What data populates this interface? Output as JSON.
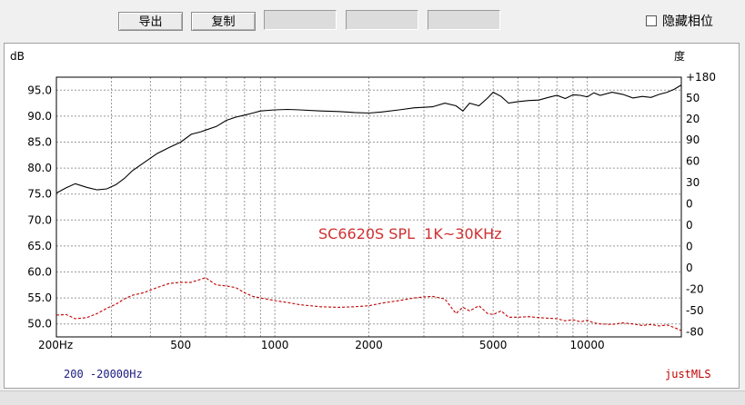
{
  "toolbar": {
    "export_label": "导出",
    "copy_label": "复制",
    "hide_phase_label": "隐藏相位",
    "hide_phase_checked": false
  },
  "colors": {
    "spl_line": "#000000",
    "phase_line": "#c00000",
    "annotation": "#d03030",
    "brand": "#c00000",
    "range_text": "#1a1a80",
    "grid": "#9a9a9a"
  },
  "chart_data": {
    "type": "line",
    "x_scale": "log",
    "xlim": [
      200,
      20000
    ],
    "ylim": [
      47.5,
      97.5
    ],
    "ylabel": "dB",
    "y2label": "度",
    "x_ticks": [
      {
        "v": 200,
        "label": "200Hz"
      },
      {
        "v": 500,
        "label": "500"
      },
      {
        "v": 1000,
        "label": "1000"
      },
      {
        "v": 2000,
        "label": "2000"
      },
      {
        "v": 5000,
        "label": "5000"
      },
      {
        "v": 10000,
        "label": "10000"
      }
    ],
    "y_ticks": [
      {
        "v": 95,
        "label": "95.0"
      },
      {
        "v": 90,
        "label": "90.0"
      },
      {
        "v": 85,
        "label": "85.0"
      },
      {
        "v": 80,
        "label": "80.0"
      },
      {
        "v": 75,
        "label": "75.0"
      },
      {
        "v": 70,
        "label": "70.0"
      },
      {
        "v": 65,
        "label": "65.0"
      },
      {
        "v": 60,
        "label": "60.0"
      },
      {
        "v": 55,
        "label": "55.0"
      },
      {
        "v": 50,
        "label": "50.0"
      }
    ],
    "y2_ticks": [
      {
        "v": 97.5,
        "label": "+180"
      },
      {
        "v": 93.5,
        "label": "50"
      },
      {
        "v": 89.5,
        "label": "20"
      },
      {
        "v": 85.4,
        "label": "90"
      },
      {
        "v": 81.3,
        "label": "60"
      },
      {
        "v": 77.2,
        "label": "30"
      },
      {
        "v": 73.1,
        "label": "0"
      },
      {
        "v": 69.0,
        "label": "0"
      },
      {
        "v": 64.9,
        "label": "0"
      },
      {
        "v": 60.8,
        "label": "0"
      },
      {
        "v": 56.7,
        "label": "-20"
      },
      {
        "v": 52.6,
        "label": "-50"
      },
      {
        "v": 48.5,
        "label": "-80"
      }
    ],
    "annotation": "SC6620S SPL  1K~30KHz",
    "range_label": "200 -20000Hz",
    "brand": "justMLS",
    "grid": true,
    "series": [
      {
        "style": "solid",
        "x": [
          200,
          215,
          230,
          250,
          270,
          290,
          310,
          330,
          350,
          380,
          420,
          460,
          500,
          540,
          580,
          600,
          650,
          700,
          750,
          800,
          850,
          900,
          1000,
          1100,
          1200,
          1400,
          1600,
          1800,
          2000,
          2200,
          2500,
          2800,
          3000,
          3200,
          3500,
          3800,
          4000,
          4200,
          4500,
          4800,
          5000,
          5300,
          5600,
          6000,
          6500,
          7000,
          7500,
          8000,
          8500,
          9000,
          9500,
          10000,
          10500,
          11000,
          12000,
          13000,
          14000,
          15000,
          16000,
          17000,
          18000,
          19000,
          20000
        ],
        "y": [
          75.2,
          76.2,
          77.0,
          76.3,
          75.8,
          76.0,
          76.8,
          78.0,
          79.5,
          81.0,
          82.8,
          84.0,
          85.0,
          86.5,
          87.0,
          87.3,
          88.0,
          89.2,
          89.8,
          90.2,
          90.6,
          91.0,
          91.2,
          91.3,
          91.2,
          91.0,
          90.9,
          90.7,
          90.6,
          90.8,
          91.2,
          91.6,
          91.7,
          91.8,
          92.5,
          92.0,
          91.0,
          92.5,
          92.0,
          93.5,
          94.6,
          93.8,
          92.5,
          92.8,
          93.0,
          93.1,
          93.6,
          94.0,
          93.4,
          94.1,
          94.0,
          93.7,
          94.5,
          94.0,
          94.6,
          94.2,
          93.5,
          93.8,
          93.6,
          94.2,
          94.6,
          95.2,
          96.0
        ]
      },
      {
        "style": "dashed",
        "x": [
          200,
          215,
          230,
          250,
          270,
          290,
          310,
          330,
          350,
          380,
          420,
          460,
          500,
          540,
          580,
          600,
          650,
          700,
          750,
          800,
          850,
          900,
          1000,
          1100,
          1200,
          1400,
          1600,
          1800,
          2000,
          2200,
          2500,
          2800,
          3000,
          3200,
          3500,
          3800,
          4000,
          4200,
          4500,
          4800,
          5000,
          5300,
          5600,
          6000,
          6500,
          7000,
          7500,
          8000,
          8500,
          9000,
          9500,
          10000,
          10500,
          11000,
          12000,
          13000,
          14000,
          15000,
          16000,
          17000,
          18000,
          19000,
          20000
        ],
        "y": [
          51.7,
          51.8,
          51.0,
          51.2,
          52.0,
          53.0,
          53.8,
          54.8,
          55.5,
          56.0,
          57.0,
          57.8,
          58.0,
          58.0,
          58.6,
          58.9,
          57.5,
          57.3,
          57.0,
          56.0,
          55.3,
          55.0,
          54.5,
          54.1,
          53.7,
          53.3,
          53.2,
          53.3,
          53.5,
          54.0,
          54.5,
          55.0,
          55.2,
          55.3,
          54.8,
          52.0,
          53.2,
          52.5,
          53.5,
          52.0,
          51.8,
          52.5,
          51.3,
          51.3,
          51.4,
          51.2,
          51.1,
          51.0,
          50.6,
          50.8,
          50.4,
          50.7,
          50.2,
          50.0,
          49.9,
          50.2,
          50.0,
          49.7,
          49.9,
          49.6,
          49.8,
          49.3,
          48.7
        ]
      }
    ]
  }
}
